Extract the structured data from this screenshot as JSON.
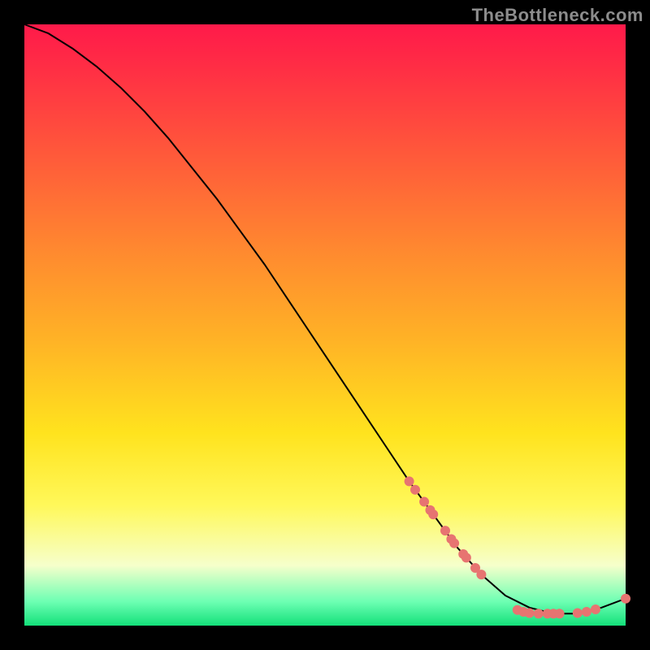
{
  "watermark": "TheBottleneck.com",
  "chart_data": {
    "type": "line",
    "title": "",
    "xlabel": "",
    "ylabel": "",
    "xlim": [
      0,
      100
    ],
    "ylim": [
      0,
      100
    ],
    "grid": false,
    "legend": false,
    "series": [
      {
        "name": "curve",
        "color": "#000000",
        "x": [
          0,
          4,
          8,
          12,
          16,
          20,
          24,
          28,
          32,
          36,
          40,
          44,
          48,
          52,
          56,
          60,
          64,
          68,
          72,
          76,
          80,
          84,
          88,
          92,
          96,
          100
        ],
        "y": [
          100,
          98.5,
          96,
          93,
          89.5,
          85.5,
          81,
          76,
          71,
          65.5,
          60,
          54,
          48,
          42,
          36,
          30,
          24,
          18.5,
          13,
          8.5,
          5,
          3,
          2,
          2,
          3,
          4.5
        ]
      }
    ],
    "markers": [
      {
        "name": "cluster-descent",
        "color": "#e77471",
        "radius": 6,
        "points": [
          [
            64,
            24.0
          ],
          [
            65,
            22.6
          ],
          [
            66.5,
            20.6
          ],
          [
            67.5,
            19.2
          ],
          [
            68,
            18.5
          ],
          [
            70,
            15.8
          ],
          [
            71,
            14.4
          ],
          [
            71.5,
            13.7
          ],
          [
            73,
            11.9
          ],
          [
            73.5,
            11.3
          ],
          [
            75,
            9.6
          ],
          [
            76,
            8.5
          ]
        ]
      },
      {
        "name": "cluster-trough",
        "color": "#e77471",
        "radius": 6,
        "points": [
          [
            82,
            2.6
          ],
          [
            83,
            2.3
          ],
          [
            84,
            2.1
          ],
          [
            85.5,
            2.0
          ],
          [
            87,
            2.0
          ],
          [
            88,
            2.0
          ],
          [
            89,
            2.0
          ],
          [
            92,
            2.1
          ],
          [
            93.5,
            2.3
          ],
          [
            95,
            2.7
          ]
        ]
      },
      {
        "name": "end-marker",
        "color": "#e77471",
        "radius": 6,
        "points": [
          [
            100,
            4.5
          ]
        ]
      }
    ]
  }
}
